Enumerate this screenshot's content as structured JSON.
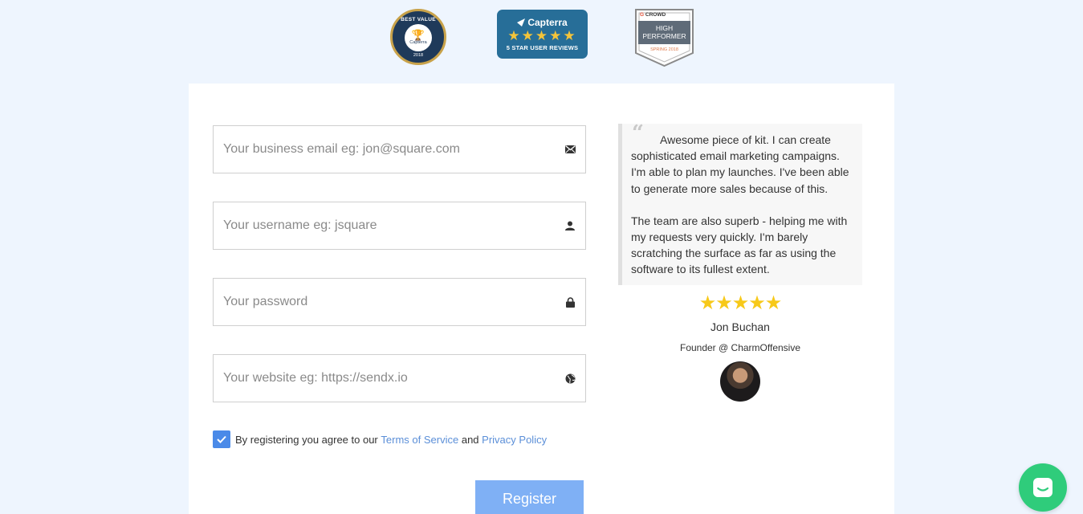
{
  "badges": {
    "best_value": {
      "top": "BEST VALUE",
      "brand": "Capterra",
      "year": "2018"
    },
    "capterra": {
      "brand": "Capterra",
      "stars": "★★★★★",
      "subtitle": "5 STAR USER REVIEWS"
    },
    "g2": {
      "brand": "CROWD",
      "line1": "HIGH",
      "line2": "PERFORMER",
      "season": "SPRING 2018"
    }
  },
  "form": {
    "email_placeholder": "Your business email eg: jon@square.com",
    "username_placeholder": "Your username eg: jsquare",
    "password_placeholder": "Your password",
    "website_placeholder": "Your website eg: https://sendx.io",
    "agree_checked": true,
    "terms_prefix": "By registering you agree to our",
    "terms_link": "Terms of Service",
    "terms_and": "and",
    "privacy_link": "Privacy Policy",
    "register_label": "Register"
  },
  "testimonial": {
    "paragraph1": "Awesome piece of kit. I can create sophisticated email marketing campaigns. I'm able to plan my launches. I've been able to generate more sales because of this.",
    "paragraph2": "The team are also superb - helping me with my requests very quickly. I'm barely scratching the surface as far as using the software to its fullest extent.",
    "rating_stars": "★★★★★",
    "author": "Jon Buchan",
    "role": "Founder @ CharmOffensive"
  },
  "colors": {
    "background": "#eef5fe",
    "checkbox": "#4a8ae8",
    "link": "#5b8fd8",
    "register_button": "#7fb0f5",
    "chat_button": "#2fcc7b",
    "star": "#f7c919"
  },
  "icons": {
    "email": "envelope-icon",
    "username": "user-icon",
    "password": "lock-icon",
    "website": "globe-icon",
    "chat": "chat-icon"
  }
}
